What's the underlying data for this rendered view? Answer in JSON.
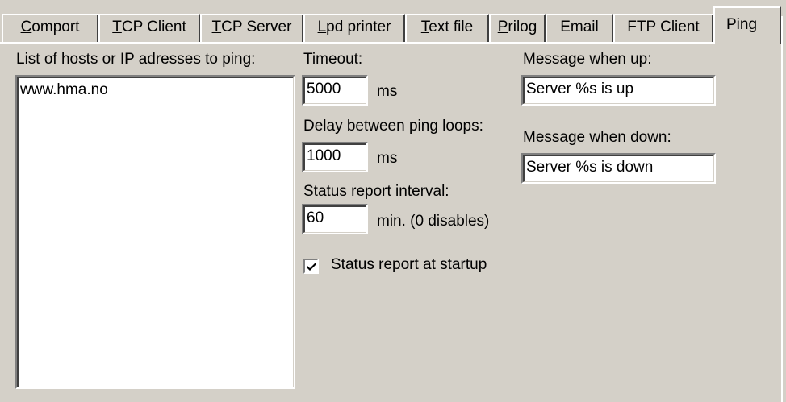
{
  "tabs": [
    {
      "pre": "",
      "key": "C",
      "post": "omport"
    },
    {
      "pre": "",
      "key": "T",
      "post": "CP Client"
    },
    {
      "pre": "",
      "key": "T",
      "post": "CP Server"
    },
    {
      "pre": "",
      "key": "L",
      "post": "pd printer"
    },
    {
      "pre": "",
      "key": "T",
      "post": "ext file"
    },
    {
      "pre": "",
      "key": "P",
      "post": "rilog"
    },
    {
      "pre": "",
      "key": "",
      "post": "Email"
    },
    {
      "pre": "",
      "key": "",
      "post": "FTP Client"
    },
    {
      "pre": "",
      "key": "",
      "post": "Ping"
    }
  ],
  "active_tab": "Ping",
  "hosts": {
    "label": "List of hosts or IP adresses to ping:",
    "items": [
      "www.hma.no"
    ]
  },
  "timeout": {
    "label": "Timeout:",
    "value": "5000",
    "unit": "ms"
  },
  "delay": {
    "label": "Delay between ping loops:",
    "value": "1000",
    "unit": "ms"
  },
  "status_interval": {
    "label": "Status report interval:",
    "value": "60",
    "unit": "min. (0 disables)"
  },
  "status_startup": {
    "label": "Status report at startup",
    "checked": true
  },
  "msg_up": {
    "label": "Message when up:",
    "value": "Server %s is up"
  },
  "msg_down": {
    "label": "Message when down:",
    "value": "Server %s is down"
  }
}
